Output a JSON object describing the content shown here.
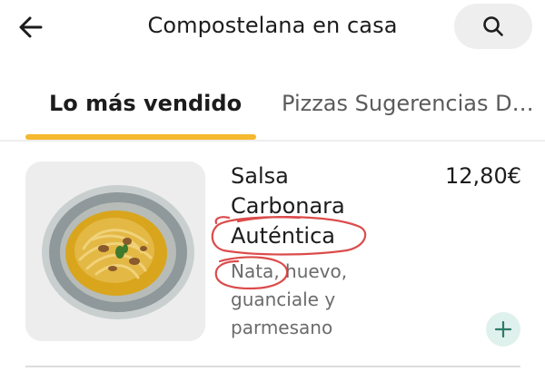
{
  "header": {
    "title": "Compostelana en casa",
    "back_icon": "arrow-left-icon",
    "search_icon": "search-icon"
  },
  "tabs": [
    {
      "label": "Lo más vendido",
      "active": true
    },
    {
      "label": "Pizzas Sugerencias De...",
      "active": false
    }
  ],
  "item": {
    "name": "Salsa Carbonara Auténtica",
    "name_lines": [
      "Salsa",
      "Carbonara",
      "Auténtica"
    ],
    "description_lines": [
      "Nata, huevo,",
      "guanciale y",
      "parmesano"
    ],
    "price": "12,80€",
    "add_icon": "plus-icon"
  },
  "colors": {
    "accent_yellow": "#f5b82e",
    "add_button_bg": "#dff1ec",
    "add_button_icon": "#2f7a6a",
    "annotation_red": "#d93838"
  }
}
